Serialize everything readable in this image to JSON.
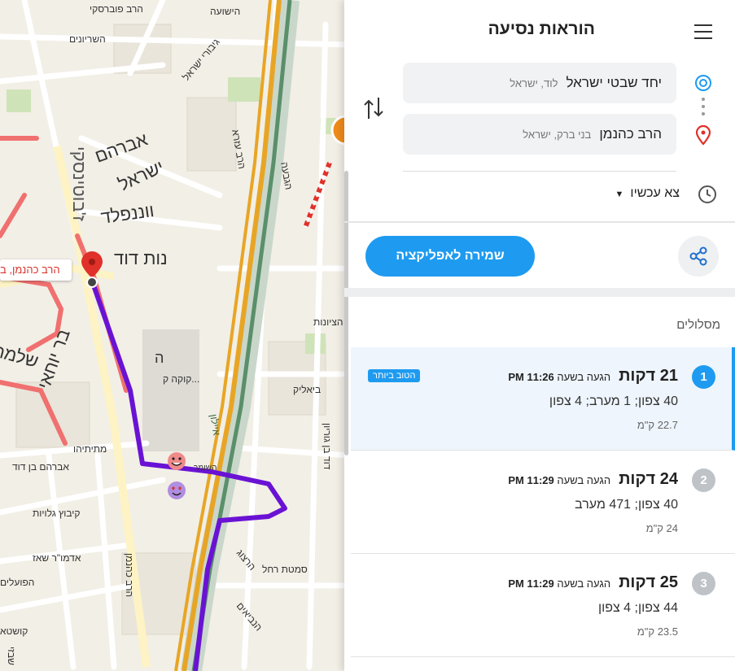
{
  "map": {
    "pin_label": "הרב כהנמן, ב",
    "streets": {
      "perbersky": "הרב פוברסקי",
      "hayeshua": "הישועה",
      "hashiryonim": "השריונים",
      "avraham": "אברהם",
      "yisrael": "ישראל",
      "vanapeld": "ווננפלד",
      "noat_david": "נות דוד",
      "jabotinsky": "ז'בוטינסקי",
      "giboray_yisrael": "גיבורי ישראל",
      "haraz_ezra": "הרב עזרא",
      "hagiva": "הגבעה",
      "ayalon": "איילון",
      "kokak": "קוקה ק...",
      "matityahu": "מתיתיהו",
      "avraham_ben_david": "אברהם בן דוד",
      "kibbutz_galuyot": "קיבוץ גלויות",
      "admor_shazar": "אדמו\"ר שאז",
      "hapoalim": "הפועלים",
      "herzog": "הרצוג",
      "harav_kahaneman": "הרב כהנמן",
      "david_ben_gurion": "דוד בן גוריון",
      "semadar_raz": "סמטת רחל",
      "bialik": "ביאליק",
      "hanavim": "הנביאים",
      "hashomer": "השומר",
      "kushta": "קושטא",
      "shlomo": "שלמה",
      "bar_yohai": "בר יוחאי",
      "shabbat": "שבזי",
      "hatzionut": "הציונות",
      "ha": "ה"
    }
  },
  "panel": {
    "title": "הוראות נסיעה",
    "origin": {
      "main": "יחד שבטי ישראל",
      "sub": "לוד, ישראל"
    },
    "destination": {
      "main": "הרב כהנמן",
      "sub": "בני ברק, ישראל"
    },
    "leave_label": "צא עכשיו",
    "save_button": "שמירה לאפליקציה",
    "routes_heading": "מסלולים",
    "routes": [
      {
        "num": "1",
        "time": "21 דקות",
        "arrival_prefix": "הגעה בשעה",
        "arrival_time": "11:26 PM",
        "via": "40 צפון; 1 מערב; 4 צפון",
        "distance": "22.7 ק\"מ",
        "badge": "הטוב ביותר"
      },
      {
        "num": "2",
        "time": "24 דקות",
        "arrival_prefix": "הגעה בשעה",
        "arrival_time": "11:29 PM",
        "via": "40 צפון; 471 מערב",
        "distance": "24 ק\"מ"
      },
      {
        "num": "3",
        "time": "25 דקות",
        "arrival_prefix": "הגעה בשעה",
        "arrival_time": "11:29 PM",
        "via": "44 צפון; 4 צפון",
        "distance": "23.5 ק\"מ"
      }
    ]
  },
  "colors": {
    "accent": "#1e9bf0",
    "route": "#6a12d4",
    "traffic": "#f07070",
    "highway": "#e8a525",
    "pin": "#e0302a"
  }
}
